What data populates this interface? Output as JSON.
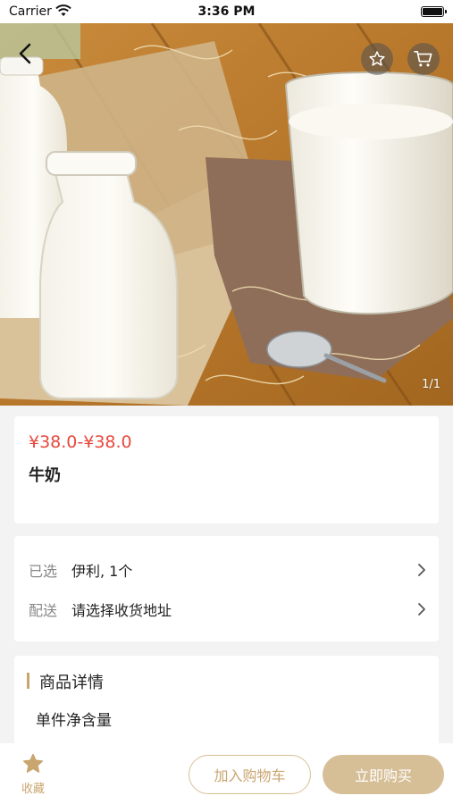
{
  "status_bar": {
    "carrier": "Carrier",
    "time": "3:36 PM"
  },
  "hero": {
    "pager": "1/1",
    "image": "milk-bottles-and-glass-photo"
  },
  "product": {
    "price": "¥38.0-¥38.0",
    "name": "牛奶"
  },
  "options": [
    {
      "key": "已选",
      "value": "伊利, 1个"
    },
    {
      "key": "配送",
      "value": "请选择收货地址"
    }
  ],
  "detail": {
    "title": "商品详情",
    "subtitle": "单件净含量"
  },
  "bottom": {
    "collect_label": "收藏",
    "add_cart_label": "加入购物车",
    "buy_label": "立即购买"
  },
  "colors": {
    "price": "#e8483e",
    "accent": "#c9a56f",
    "buy_bg": "#d6bf97"
  },
  "icons": [
    "wifi-icon",
    "battery-icon",
    "back-icon",
    "star-icon",
    "cart-icon",
    "chevron-right-icon"
  ]
}
